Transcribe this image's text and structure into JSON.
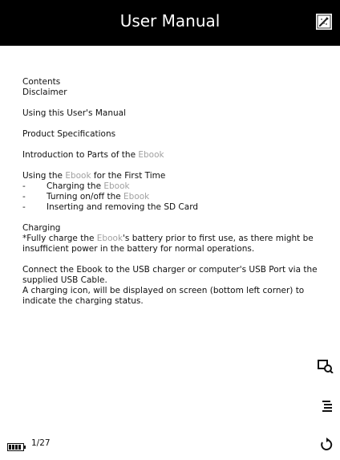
{
  "header": {
    "title": "User Manual",
    "icon": "edit-note-icon"
  },
  "manual": {
    "contents_heading": "Contents",
    "disclaimer": "Disclaimer",
    "using_manual": "Using this User's Manual",
    "specs": "Product Specifications",
    "intro_prefix": "Introduction to Parts of the ",
    "ebook_word": "Ebook",
    "first_time_prefix": "Using the ",
    "first_time_suffix": " for the First Time",
    "bullet_dash": "-",
    "bullet1_prefix": "Charging the ",
    "bullet2_prefix": "Turning on/off the ",
    "bullet3": "Inserting and removing the SD Card",
    "charging_heading": "Charging",
    "charge_note_prefix": "*Fully charge the ",
    "charge_note_suffix": "'s battery prior to first use, as there might be insufficient power in the battery for normal operations.",
    "connect_text": "Connect the Ebook to the USB charger or computer's USB Port via the supplied USB Cable.",
    "icon_text": "A charging icon, will be displayed on screen (bottom left corner) to indicate the charging status."
  },
  "side_tools": {
    "zoom_icon": "zoom-page-icon",
    "toc_icon": "table-of-contents-icon",
    "refresh_icon": "rotate-refresh-icon"
  },
  "footer": {
    "battery_icon": "battery-full-icon",
    "page_indicator": "1/27"
  },
  "colors": {
    "header_bg": "#000000",
    "header_text": "#ffffff",
    "muted_link": "#a0a0a0",
    "body_text": "#111111"
  }
}
